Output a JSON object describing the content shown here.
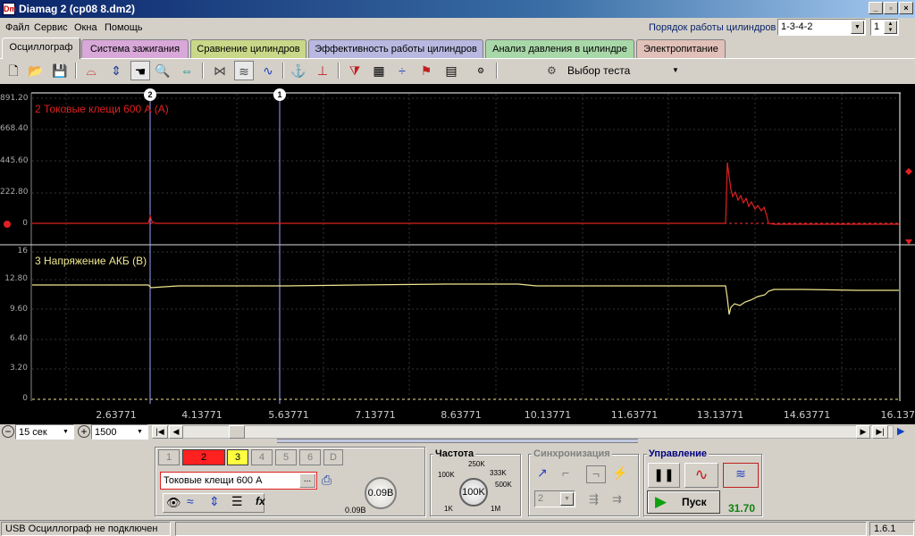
{
  "window": {
    "title": "Diamag 2 (cp08 8.dm2)",
    "icon_text": "Dm"
  },
  "menu": [
    "Файл",
    "Сервис",
    "Окна",
    "Помощь"
  ],
  "cylinder_order": {
    "label": "Порядок работы цилиндров",
    "value": "1-3-4-2",
    "cylinder": "1"
  },
  "tabs": [
    {
      "label": "Осциллограф",
      "color": "#d4d0c8"
    },
    {
      "label": "Система зажигания",
      "color": "#d8a8d8"
    },
    {
      "label": "Сравнение цилиндров",
      "color": "#c8d888"
    },
    {
      "label": "Эффективность работы цилиндров",
      "color": "#b8b8e0"
    },
    {
      "label": "Анализ давления в цилиндре",
      "color": "#a8d8a8"
    },
    {
      "label": "Электропитание",
      "color": "#e0c0b8"
    }
  ],
  "toolbar": {
    "test_select_label": "Выбор теста"
  },
  "scope": {
    "cursor1_label": "1",
    "cursor2_label": "2",
    "channel_top": {
      "title": "2 Токовые клещи 600 А (А)",
      "color": "#e02020",
      "y_ticks": [
        "891.20",
        "668.40",
        "445.60",
        "222.80",
        "0"
      ]
    },
    "channel_bottom": {
      "title": "3 Напряжение АКБ (В)",
      "color": "#f0e890",
      "y_ticks": [
        "16",
        "12.80",
        "9.60",
        "6.40",
        "3.20",
        "0"
      ]
    },
    "x_ticks": [
      "2.63771",
      "4.13771",
      "5.63771",
      "7.13771",
      "8.63771",
      "10.13771",
      "11.63771",
      "13.13771",
      "14.63771",
      "16.137"
    ]
  },
  "timebase": {
    "duration": "15 сек",
    "points": "1500"
  },
  "channels_panel": {
    "buttons": [
      "1",
      "2",
      "3",
      "4",
      "5",
      "6",
      "D"
    ],
    "active_colors": {
      "2": "#ff2020",
      "3": "#ffff40"
    },
    "probe_name": "Токовые клещи 600 А",
    "probe_btn": "...",
    "knob_value": "0.09В",
    "knob_min": "0.09В"
  },
  "frequency": {
    "title": "Частота",
    "value": "100K",
    "marks": [
      "250K",
      "333K",
      "500K",
      "1M",
      "1K",
      "100K"
    ]
  },
  "sync": {
    "title": "Синхронизация",
    "channel": "2"
  },
  "control": {
    "title": "Управление",
    "start_label": "Пуск",
    "value": "31.70"
  },
  "status": {
    "message": "USB Осциллограф не подключен",
    "version": "1.6.1"
  }
}
